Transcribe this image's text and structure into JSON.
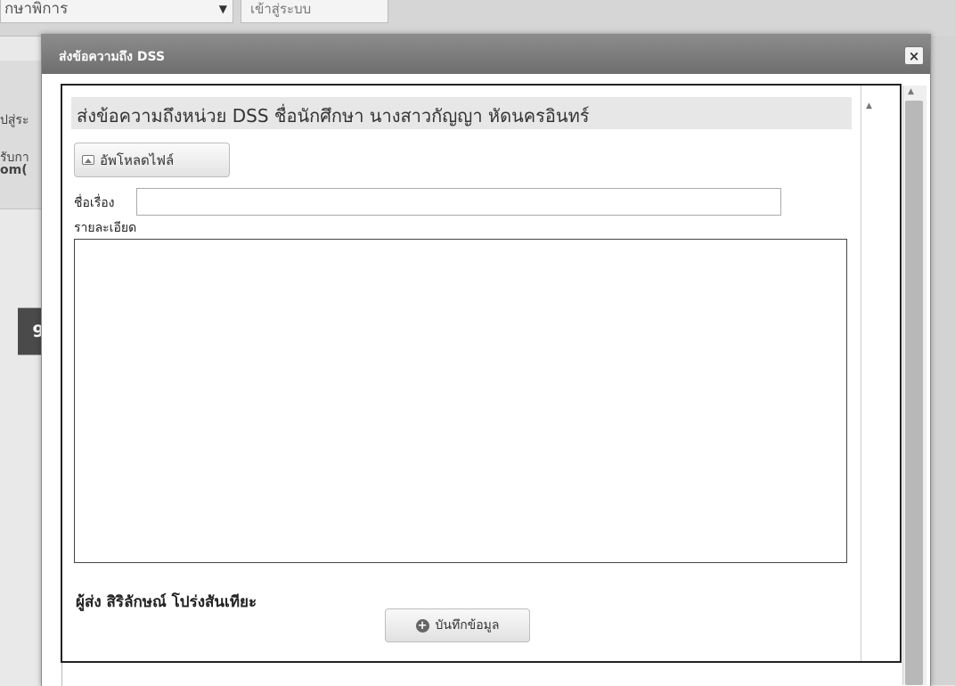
{
  "background": {
    "program_select": "กษาพิการ",
    "login_button": "เข้าสู่ระบบ",
    "side_text_1": "ปสู่ระ",
    "side_text_2": "รับกา",
    "side_text_3": "om(",
    "step_badge": "9"
  },
  "dialog": {
    "title": "ส่งข้อความถึง DSS",
    "close_icon": "×",
    "heading": "ส่งข้อความถึงหน่วย DSS ชื่อนักศึกษา นางสาวกัญญา หัดนครอินทร์",
    "upload_label": "อัพโหลดไฟล์",
    "subject_label": "ชื่อเรื่อง",
    "subject_value": "",
    "detail_label": "รายละเอียด",
    "detail_value": "",
    "sender": "ผู้ส่ง สิริลักษณ์ โปร่งสันเทียะ",
    "save_label": "บันทึกข้อมูล"
  },
  "colors": {
    "header": "#7d7d7d",
    "badge": "#4a4a4a"
  }
}
